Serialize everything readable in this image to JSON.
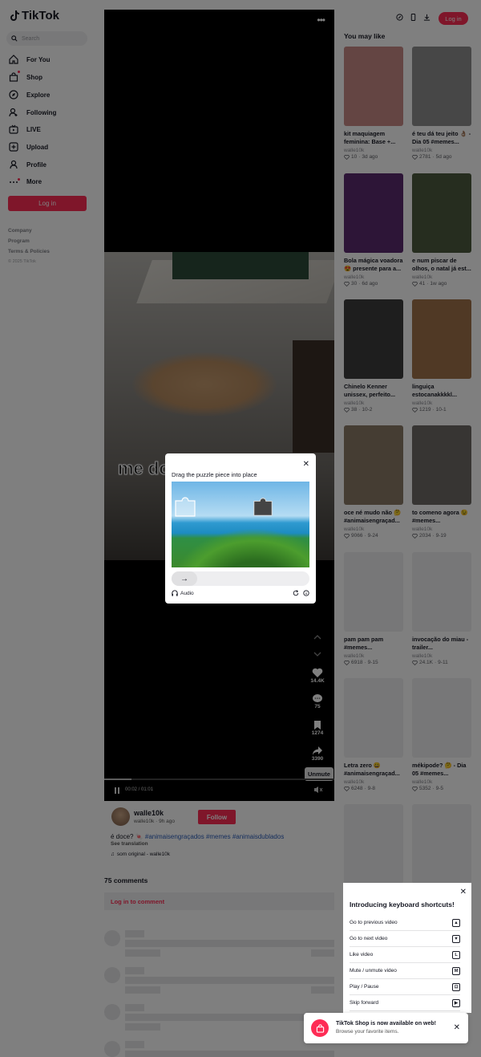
{
  "brand": {
    "name": "TikTok",
    "accent": "#fe2c55"
  },
  "search": {
    "placeholder": "Search"
  },
  "sidebar": {
    "items": [
      {
        "label": "For You",
        "icon": "home-icon"
      },
      {
        "label": "Shop",
        "icon": "shop-icon"
      },
      {
        "label": "Explore",
        "icon": "compass-icon"
      },
      {
        "label": "Following",
        "icon": "following-icon"
      },
      {
        "label": "LIVE",
        "icon": "live-icon"
      },
      {
        "label": "Upload",
        "icon": "upload-icon"
      },
      {
        "label": "Profile",
        "icon": "profile-icon"
      },
      {
        "label": "More",
        "icon": "more-icon"
      }
    ],
    "login": "Log in",
    "links": [
      "Company",
      "Program",
      "Terms & Policies"
    ],
    "copyright": "© 2025 TikTok"
  },
  "header": {
    "login": "Log in"
  },
  "video": {
    "caption_overlay": "me do",
    "actions": {
      "likes": "14.4K",
      "comments": "75",
      "saves": "1274",
      "shares": "3390"
    },
    "unmute_tooltip": "Unmute",
    "time": "00:02 / 01:01",
    "progress_fraction": 0.12
  },
  "author": {
    "name": "walle10k",
    "sub": "walle10k · 9h ago",
    "follow": "Follow",
    "desc_text": "é doce? 🍬",
    "tags": "#animaisengraçados #memes #animaisdublados",
    "see_translation": "See translation",
    "music": "som original - walle10k"
  },
  "comments": {
    "count": "75 comments",
    "login_prompt": "Log in to comment"
  },
  "recommendations": {
    "heading": "You may like",
    "cards": [
      {
        "title": "kit maquiagem feminina: Base +...",
        "author": "walle10k",
        "likes": "10",
        "age": "3d ago",
        "thumb": "#c98a86"
      },
      {
        "title": "é teu dá teu jeito 👌🏽 - Dia 05 #memes...",
        "author": "walle10k",
        "likes": "2781",
        "age": "5d ago",
        "thumb": "#8e8e8e"
      },
      {
        "title": "Bola mágica voadora 😍 presente para a...",
        "author": "walle10k",
        "likes": "30",
        "age": "6d ago",
        "thumb": "#5a2a6e"
      },
      {
        "title": "e num piscar de olhos, o natal já est...",
        "author": "walle10k",
        "likes": "41",
        "age": "1w ago",
        "thumb": "#4d5a3e"
      },
      {
        "title": "Chinelo Kenner unissex, perfeito...",
        "author": "walle10k",
        "likes": "38",
        "age": "10-2",
        "thumb": "#3c3c3c"
      },
      {
        "title": "linguiça estocanakkkkl...",
        "author": "walle10k",
        "likes": "1219",
        "age": "10-1",
        "thumb": "#a0724a"
      },
      {
        "title": "oce né mudo não 🤔 #animaisengraçad...",
        "author": "walle10k",
        "likes": "9066",
        "age": "9-24",
        "thumb": "#8a7a66"
      },
      {
        "title": "to comeno agora 😉 #memes...",
        "author": "walle10k",
        "likes": "2034",
        "age": "9-19",
        "thumb": "#6f6b66"
      },
      {
        "title": "pam pam pam #memes...",
        "author": "walle10k",
        "likes": "6918",
        "age": "9-15",
        "thumb": "#eeeef0"
      },
      {
        "title": "invocação do miau - trailer...",
        "author": "walle10k",
        "likes": "24.1K",
        "age": "9-11",
        "thumb": "#eeeef0"
      },
      {
        "title": "Letra zero 😀 #animaisengraçad...",
        "author": "walle10k",
        "likes": "6248",
        "age": "9-8",
        "thumb": "#eeeef0"
      },
      {
        "title": "mékipode? 🤔 - Dia 05 #memes...",
        "author": "walle10k",
        "likes": "5352",
        "age": "9-5",
        "thumb": "#eeeef0"
      }
    ]
  },
  "shortcuts": {
    "title": "Introducing keyboard shortcuts!",
    "rows": [
      {
        "label": "Go to previous video",
        "key": "▲"
      },
      {
        "label": "Go to next video",
        "key": "▼"
      },
      {
        "label": "Like video",
        "key": "L"
      },
      {
        "label": "Mute / unmute video",
        "key": "M"
      },
      {
        "label": "Play / Pause",
        "key": "⊡"
      },
      {
        "label": "Skip forward",
        "key": "▶"
      }
    ]
  },
  "toast": {
    "title": "TikTok Shop is now available on web!",
    "subtitle": "Browse your favorite items."
  },
  "captcha": {
    "title": "Drag the puzzle piece into place",
    "audio": "Audio",
    "knob": "→"
  }
}
